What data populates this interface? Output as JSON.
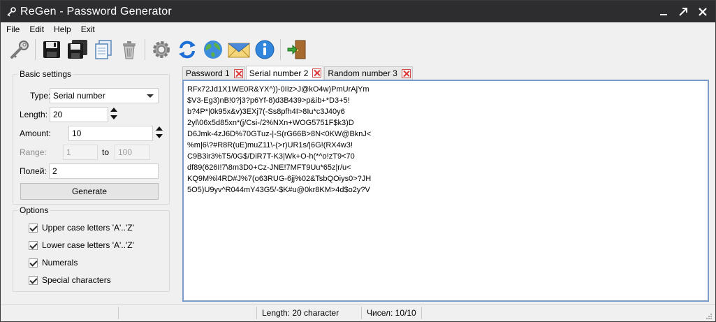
{
  "window": {
    "title": "ReGen - Password Generator"
  },
  "menu": {
    "items": [
      "File",
      "Edit",
      "Help",
      "Exit"
    ]
  },
  "toolbar": {
    "icons": [
      "key-icon",
      "save-icon",
      "save-all-icon",
      "copy-icon",
      "delete-icon",
      "settings-icon",
      "refresh-icon",
      "globe-icon",
      "mail-icon",
      "info-icon",
      "exit-door-icon"
    ]
  },
  "basic_settings": {
    "title": "Basic settings",
    "type_label": "Type:",
    "type_value": "Serial number",
    "length_label": "Length:",
    "length_value": "20",
    "amount_label": "Amount:",
    "amount_value": "10",
    "range_label": "Range:",
    "range_from": "1",
    "range_to_label": "to",
    "range_to": "100",
    "field_label": "Полей:",
    "field_value": "2",
    "generate_label": "Generate"
  },
  "options": {
    "title": "Options",
    "items": [
      {
        "label": "Upper case letters 'A'..'Z'",
        "checked": true
      },
      {
        "label": "Lower case letters 'A'..'Z'",
        "checked": true
      },
      {
        "label": "Numerals",
        "checked": true
      },
      {
        "label": "Special characters",
        "checked": true
      }
    ]
  },
  "tabs": [
    {
      "label": "Password 1",
      "active": false
    },
    {
      "label": "Serial number 2",
      "active": true
    },
    {
      "label": "Random number 3",
      "active": false
    }
  ],
  "output_lines": [
    "RFx72Jd1X1WE0R&YX^))-0IIz>J@kO4w)PmUrAjYm",
    "$V3-Eg3)nB!0?j3?p6Yf-8)d3B439>p&ib+*D3+5!",
    "b?4P*|0k95x&v)3EXj7(-Ss8pfh4I>8Iu*c3J40y6",
    "2yl\\06x5d85xn*(j/Csi-/2%NXn+WOG5751F$k3)D",
    "D6Jmk-4zJ6D%70GTuz-|-S(rG66B>8N<0KW@BknJ<",
    "%m|6\\?#R8R(uE)muZ11\\-(>r)UR1s/|6G!(RX4w3!",
    "C9B3ir3%T5/0G$/DiR7T-K3|Wk+O-h(*^o!zT9<70",
    "df89(626I!7\\8m3D0+Cz-JNE!7MFT9Uu*65z|r/u<",
    "KQ9M%l4RD#J%7(o63RUG-6jj%02&TsbQOiys0>?JH",
    "5O5)U9yv^R044mY43G5/-$K#u@0kr8KM>4d$o2y?V"
  ],
  "status": {
    "length_text": "Length: 20 character",
    "count_text": "Чисел: 10/10"
  },
  "colors": {
    "titlebar": "#2d2d30",
    "editor_border": "#7a9cc6",
    "tab_close": "#d33333"
  }
}
